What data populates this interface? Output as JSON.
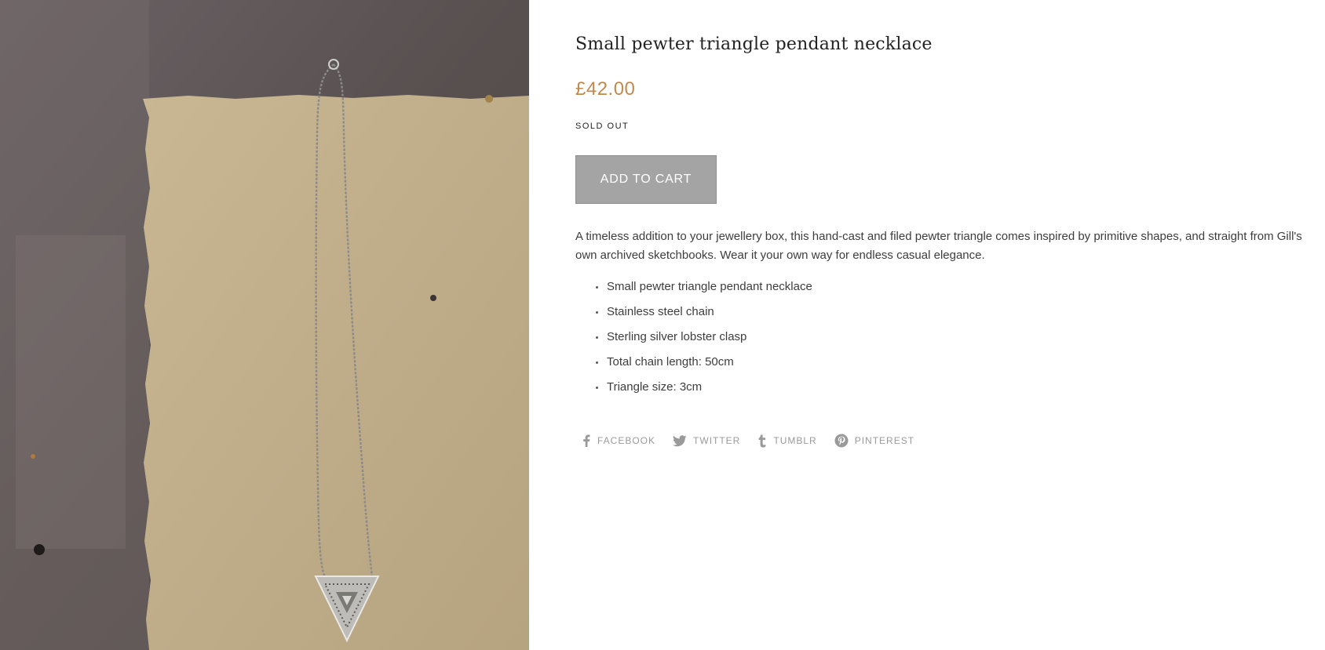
{
  "product": {
    "title": "Small pewter triangle pendant necklace",
    "price": "£42.00",
    "stock_status": "SOLD OUT",
    "add_to_cart_label": "ADD TO CART",
    "description": "A timeless addition to your jewellery box, this hand-cast and filed pewter triangle comes inspired by primitive shapes, and straight from Gill's own archived sketchbooks. Wear it your own way for endless casual elegance.",
    "features": [
      "Small pewter triangle pendant necklace",
      "Stainless steel chain",
      "Sterling silver lobster clasp",
      "Total chain length: 50cm",
      "Triangle size: 3cm"
    ]
  },
  "share": {
    "facebook": {
      "label": "FACEBOOK",
      "icon": "facebook-icon"
    },
    "twitter": {
      "label": "TWITTER",
      "icon": "twitter-icon"
    },
    "tumblr": {
      "label": "TUMBLR",
      "icon": "tumblr-icon"
    },
    "pinterest": {
      "label": "PINTEREST",
      "icon": "pinterest-icon"
    }
  },
  "colors": {
    "price": "#c08a4f",
    "button_bg": "#a4a4a4",
    "share_text": "#9a9a9a"
  }
}
